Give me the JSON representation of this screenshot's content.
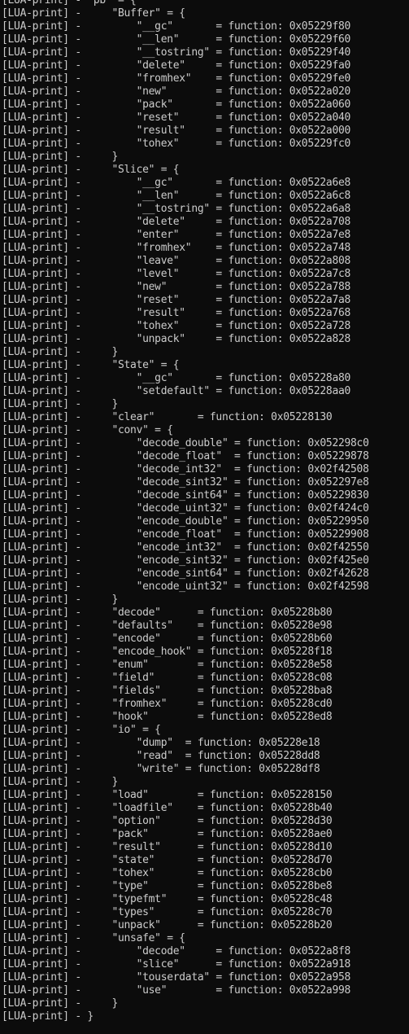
{
  "console": {
    "lines": [
      "[LUA-print] - \"pb\" = {",
      "[LUA-print] -     \"Buffer\" = {",
      "[LUA-print] -         \"__gc\"       = function: 0x05229f80",
      "[LUA-print] -         \"__len\"      = function: 0x05229f60",
      "[LUA-print] -         \"__tostring\" = function: 0x05229f40",
      "[LUA-print] -         \"delete\"     = function: 0x05229fa0",
      "[LUA-print] -         \"fromhex\"    = function: 0x05229fe0",
      "[LUA-print] -         \"new\"        = function: 0x0522a020",
      "[LUA-print] -         \"pack\"       = function: 0x0522a060",
      "[LUA-print] -         \"reset\"      = function: 0x0522a040",
      "[LUA-print] -         \"result\"     = function: 0x0522a000",
      "[LUA-print] -         \"tohex\"      = function: 0x05229fc0",
      "[LUA-print] -     }",
      "[LUA-print] -     \"Slice\" = {",
      "[LUA-print] -         \"__gc\"       = function: 0x0522a6e8",
      "[LUA-print] -         \"__len\"      = function: 0x0522a6c8",
      "[LUA-print] -         \"__tostring\" = function: 0x0522a6a8",
      "[LUA-print] -         \"delete\"     = function: 0x0522a708",
      "[LUA-print] -         \"enter\"      = function: 0x0522a7e8",
      "[LUA-print] -         \"fromhex\"    = function: 0x0522a748",
      "[LUA-print] -         \"leave\"      = function: 0x0522a808",
      "[LUA-print] -         \"level\"      = function: 0x0522a7c8",
      "[LUA-print] -         \"new\"        = function: 0x0522a788",
      "[LUA-print] -         \"reset\"      = function: 0x0522a7a8",
      "[LUA-print] -         \"result\"     = function: 0x0522a768",
      "[LUA-print] -         \"tohex\"      = function: 0x0522a728",
      "[LUA-print] -         \"unpack\"     = function: 0x0522a828",
      "[LUA-print] -     }",
      "[LUA-print] -     \"State\" = {",
      "[LUA-print] -         \"__gc\"       = function: 0x05228a80",
      "[LUA-print] -         \"setdefault\" = function: 0x05228aa0",
      "[LUA-print] -     }",
      "[LUA-print] -     \"clear\"       = function: 0x05228130",
      "[LUA-print] -     \"conv\" = {",
      "[LUA-print] -         \"decode_double\" = function: 0x052298c0",
      "[LUA-print] -         \"decode_float\"  = function: 0x05229878",
      "[LUA-print] -         \"decode_int32\"  = function: 0x02f42508",
      "[LUA-print] -         \"decode_sint32\" = function: 0x052297e8",
      "[LUA-print] -         \"decode_sint64\" = function: 0x05229830",
      "[LUA-print] -         \"decode_uint32\" = function: 0x02f424c0",
      "[LUA-print] -         \"encode_double\" = function: 0x05229950",
      "[LUA-print] -         \"encode_float\"  = function: 0x05229908",
      "[LUA-print] -         \"encode_int32\"  = function: 0x02f42550",
      "[LUA-print] -         \"encode_sint32\" = function: 0x02f425e0",
      "[LUA-print] -         \"encode_sint64\" = function: 0x02f42628",
      "[LUA-print] -         \"encode_uint32\" = function: 0x02f42598",
      "[LUA-print] -     }",
      "[LUA-print] -     \"decode\"      = function: 0x05228b80",
      "[LUA-print] -     \"defaults\"    = function: 0x05228e98",
      "[LUA-print] -     \"encode\"      = function: 0x05228b60",
      "[LUA-print] -     \"encode_hook\" = function: 0x05228f18",
      "[LUA-print] -     \"enum\"        = function: 0x05228e58",
      "[LUA-print] -     \"field\"       = function: 0x05228c08",
      "[LUA-print] -     \"fields\"      = function: 0x05228ba8",
      "[LUA-print] -     \"fromhex\"     = function: 0x05228cd0",
      "[LUA-print] -     \"hook\"        = function: 0x05228ed8",
      "[LUA-print] -     \"io\" = {",
      "[LUA-print] -         \"dump\"  = function: 0x05228e18",
      "[LUA-print] -         \"read\"  = function: 0x05228dd8",
      "[LUA-print] -         \"write\" = function: 0x05228df8",
      "[LUA-print] -     }",
      "[LUA-print] -     \"load\"        = function: 0x05228150",
      "[LUA-print] -     \"loadfile\"    = function: 0x05228b40",
      "[LUA-print] -     \"option\"      = function: 0x05228d30",
      "[LUA-print] -     \"pack\"        = function: 0x05228ae0",
      "[LUA-print] -     \"result\"      = function: 0x05228d10",
      "[LUA-print] -     \"state\"       = function: 0x05228d70",
      "[LUA-print] -     \"tohex\"       = function: 0x05228cb0",
      "[LUA-print] -     \"type\"        = function: 0x05228be8",
      "[LUA-print] -     \"typefmt\"     = function: 0x05228c48",
      "[LUA-print] -     \"types\"       = function: 0x05228c70",
      "[LUA-print] -     \"unpack\"      = function: 0x05228b20",
      "[LUA-print] -     \"unsafe\" = {",
      "[LUA-print] -         \"decode\"     = function: 0x0522a8f8",
      "[LUA-print] -         \"slice\"      = function: 0x0522a918",
      "[LUA-print] -         \"touserdata\" = function: 0x0522a958",
      "[LUA-print] -         \"use\"        = function: 0x0522a998",
      "[LUA-print] -     }",
      "[LUA-print] - }"
    ],
    "colors": {
      "background": "#0c0c0c",
      "text": "#cccccc"
    }
  }
}
